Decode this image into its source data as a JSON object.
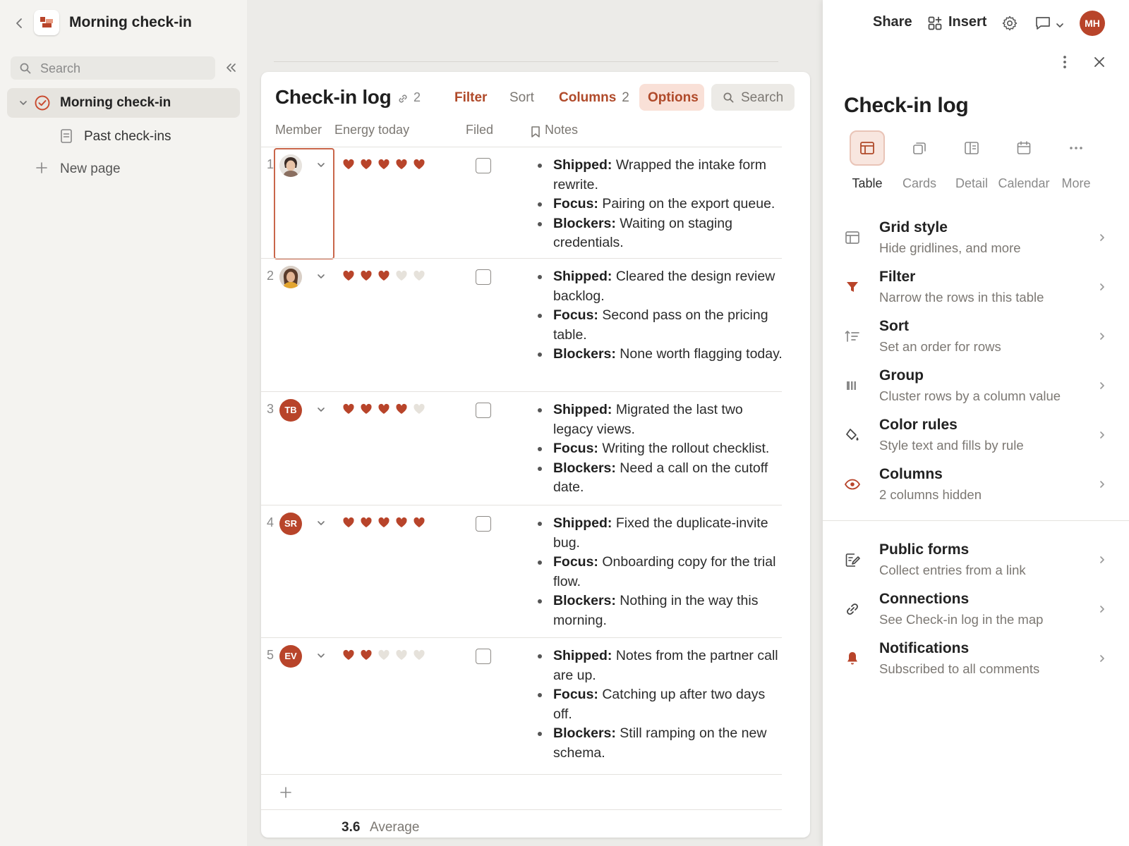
{
  "sidebar": {
    "title": "Morning check-in",
    "search_placeholder": "Search",
    "active_item": "Morning check-in",
    "sub_item": "Past check-ins",
    "new_page": "New page"
  },
  "table": {
    "title": "Check-in log",
    "link_count": "2",
    "toolbar": {
      "filter": "Filter",
      "sort": "Sort",
      "columns": "Columns",
      "columns_count": "2",
      "options": "Options",
      "search": "Search"
    },
    "columns": [
      "Member",
      "Energy today",
      "Filed",
      "Notes"
    ],
    "rows": [
      {
        "num": "1",
        "avatar": "",
        "energy": 5,
        "filed": false,
        "shipped_label": "Shipped:",
        "shipped": "Wrapped the intake form rewrite.",
        "focus_label": "Focus:",
        "focus": "Pairing on the export queue.",
        "blockers_label": "Blockers:",
        "blockers": "Waiting on staging credentials."
      },
      {
        "num": "2",
        "avatar": "",
        "energy": 3,
        "filed": false,
        "shipped_label": "Shipped:",
        "shipped": "Cleared the design review backlog.",
        "focus_label": "Focus:",
        "focus": "Second pass on the pricing table.",
        "blockers_label": "Blockers:",
        "blockers": "None worth flagging today."
      },
      {
        "num": "3",
        "avatar": "TB",
        "energy": 4,
        "filed": false,
        "shipped_label": "Shipped:",
        "shipped": "Migrated the last two legacy views.",
        "focus_label": "Focus:",
        "focus": "Writing the rollout checklist.",
        "blockers_label": "Blockers:",
        "blockers": "Need a call on the cutoff date."
      },
      {
        "num": "4",
        "avatar": "SR",
        "energy": 5,
        "filed": false,
        "shipped_label": "Shipped:",
        "shipped": "Fixed the duplicate-invite bug.",
        "focus_label": "Focus:",
        "focus": "Onboarding copy for the trial flow.",
        "blockers_label": "Blockers:",
        "blockers": "Nothing in the way this morning."
      },
      {
        "num": "5",
        "avatar": "EV",
        "energy": 2,
        "filed": false,
        "shipped_label": "Shipped:",
        "shipped": "Notes from the partner call are up.",
        "focus_label": "Focus:",
        "focus": "Catching up after two days off.",
        "blockers_label": "Blockers:",
        "blockers": "Still ramping on the new schema."
      }
    ],
    "energy_max": 5,
    "average_value": "3.6",
    "average_label": "Average"
  },
  "panel": {
    "share": "Share",
    "insert": "Insert",
    "user_initials": "MH",
    "title": "Check-in log",
    "views": [
      {
        "label": "Table",
        "icon": "table-icon",
        "active": true
      },
      {
        "label": "Cards",
        "icon": "cards-icon",
        "active": false
      },
      {
        "label": "Detail",
        "icon": "detail-icon",
        "active": false
      },
      {
        "label": "Calendar",
        "icon": "calendar-icon",
        "active": false
      },
      {
        "label": "More",
        "icon": "more-icon",
        "active": false
      }
    ],
    "options": [
      {
        "title": "Grid style",
        "subtitle": "Hide gridlines, and more",
        "icon": "grid-icon"
      },
      {
        "title": "Filter",
        "subtitle": "Narrow the rows in this table",
        "icon": "filter-icon"
      },
      {
        "title": "Sort",
        "subtitle": "Set an order for rows",
        "icon": "sort-icon"
      },
      {
        "title": "Group",
        "subtitle": "Cluster rows by a column value",
        "icon": "group-icon"
      },
      {
        "title": "Color rules",
        "subtitle": "Style text and fills by rule",
        "icon": "paint-bucket-icon"
      },
      {
        "title": "Columns",
        "subtitle": "2 columns hidden",
        "icon": "eye-icon"
      }
    ],
    "options2": [
      {
        "title": "Public forms",
        "subtitle": "Collect entries from a link",
        "icon": "form-icon"
      },
      {
        "title": "Connections",
        "subtitle": "See Check-in log in the map",
        "icon": "link-icon"
      },
      {
        "title": "Notifications",
        "subtitle": "Subscribed to all comments",
        "icon": "bell-icon"
      }
    ]
  },
  "colors": {
    "accent": "#b04a2a",
    "heart_on": "#b8442a",
    "heart_off": "#e6e2db"
  }
}
